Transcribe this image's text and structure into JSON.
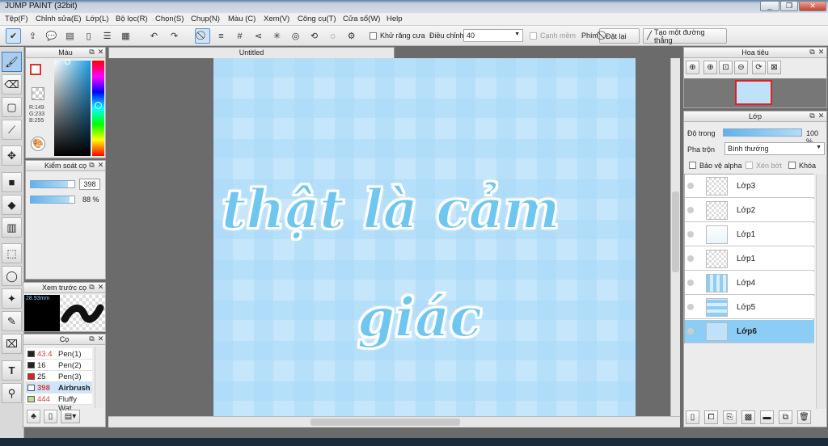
{
  "window": {
    "title": "JUMP PAINT (32bit)",
    "minimize": "_",
    "maximize": "❐",
    "close": "✕"
  },
  "menu": [
    "Tệp(F)",
    "Chỉnh sửa(E)",
    "Lớp(L)",
    "Bộ lọc(R)",
    "Chọn(S)",
    "Chụp(N)",
    "Màu (C)",
    "Xem(V)",
    "Công cụ(T)",
    "Cửa sổ(W)",
    "Help"
  ],
  "toolbar": {
    "antialias_label": "Khử răng cưa",
    "adjust_label": "Điều chỉnh",
    "adjust_value": "40",
    "smooth_label": "Cạnh mềm",
    "key_label": "Phím",
    "reset_label": "Đặt lại",
    "line_label": "Tạo một đường thẳng"
  },
  "color_panel": {
    "title": "Màu",
    "r": "R:149",
    "g": "G:233",
    "b": "B:255"
  },
  "brush_control": {
    "title": "Kiểm soát cọ",
    "size": "398",
    "opacity": "88 %",
    "size_fraction": 0.85,
    "opacity_fraction": 0.88
  },
  "brush_preview": {
    "title": "Xem trước cọ",
    "size_text": "28.93mm"
  },
  "brushes": {
    "title": "Cọ",
    "items": [
      {
        "size": "43.4",
        "name": "Pen(1)",
        "color": "#222222",
        "size_color": "#d04040"
      },
      {
        "size": "16",
        "name": "Pen(2)",
        "color": "#222222",
        "size_color": "#222222"
      },
      {
        "size": "25",
        "name": "Pen(3)",
        "color": "#e02020",
        "size_color": "#222222"
      },
      {
        "size": "398",
        "name": "Airbrush",
        "color": "#ffffff",
        "size_color": "#d04040"
      },
      {
        "size": "444",
        "name": "Fluffy Wat",
        "color": "#b8e08a",
        "size_color": "#d04040"
      }
    ]
  },
  "document": {
    "tab": "Untitled",
    "line1": "thật  là  cảm",
    "line2": "giác"
  },
  "navigator": {
    "title": "Hoa tiêu"
  },
  "layers": {
    "title": "Lớp",
    "opacity_label": "Độ trong",
    "opacity_value": "100 %",
    "blend_label": "Pha trộn",
    "blend_value": "Bình thường",
    "protect_alpha": "Bảo vệ alpha",
    "clip": "Xén bớt",
    "lock": "Khóa",
    "items": [
      {
        "name": "Lớp3",
        "bold": false,
        "selected": false
      },
      {
        "name": "Lớp2",
        "bold": false,
        "selected": false
      },
      {
        "name": "Lớp1",
        "bold": false,
        "selected": false
      },
      {
        "name": "Lớp1",
        "bold": false,
        "selected": false
      },
      {
        "name": "Lớp4",
        "bold": false,
        "selected": false
      },
      {
        "name": "Lớp5",
        "bold": false,
        "selected": false
      },
      {
        "name": "Lớp6",
        "bold": true,
        "selected": true
      }
    ]
  }
}
